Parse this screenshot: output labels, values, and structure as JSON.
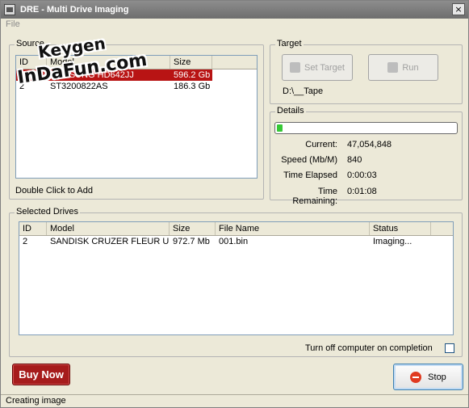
{
  "window": {
    "title": "DRE - Multi Drive Imaging",
    "close_glyph": "×"
  },
  "menu": {
    "file": "File"
  },
  "source": {
    "legend": "Source",
    "columns": [
      "ID",
      "Model",
      "Size"
    ],
    "rows": [
      {
        "id": "1",
        "model": "SAMSUNG HD642JJ",
        "size": "596.2 Gb",
        "selected": true
      },
      {
        "id": "2",
        "model": "ST3200822AS",
        "size": "186.3 Gb",
        "selected": false
      }
    ],
    "hint": "Double Click to Add"
  },
  "target": {
    "legend": "Target",
    "set_target_label": "Set Target",
    "run_label": "Run",
    "path": "D:\\__Tape"
  },
  "details": {
    "legend": "Details",
    "progress": 0.02,
    "current_label": "Current:",
    "current_value": "47,054,848",
    "speed_label": "Speed (Mb/M)",
    "speed_value": "840",
    "elapsed_label": "Time Elapsed",
    "elapsed_value": "0:00:03",
    "remaining_label": "Time Remaining:",
    "remaining_value": "0:01:08"
  },
  "selected": {
    "legend": "Selected Drives",
    "columns": [
      "ID",
      "Model",
      "Size",
      "File Name",
      "Status"
    ],
    "rows": [
      {
        "id": "2",
        "model": "SANDISK CRUZER FLEUR U...",
        "size": "972.7 Mb",
        "file": "001.bin",
        "status": "Imaging..."
      }
    ]
  },
  "options": {
    "turn_off_label": "Turn off computer on completion",
    "turn_off_checked": false
  },
  "buttons": {
    "buy_now": "Buy Now",
    "stop": "Stop"
  },
  "statusbar": {
    "text": "Creating image"
  },
  "watermark": {
    "line1": "Keygen",
    "line2": "InDaFun.com"
  },
  "colors": {
    "selection": "#b81414",
    "progress": "#37c837",
    "buy": "#a61c1c"
  }
}
